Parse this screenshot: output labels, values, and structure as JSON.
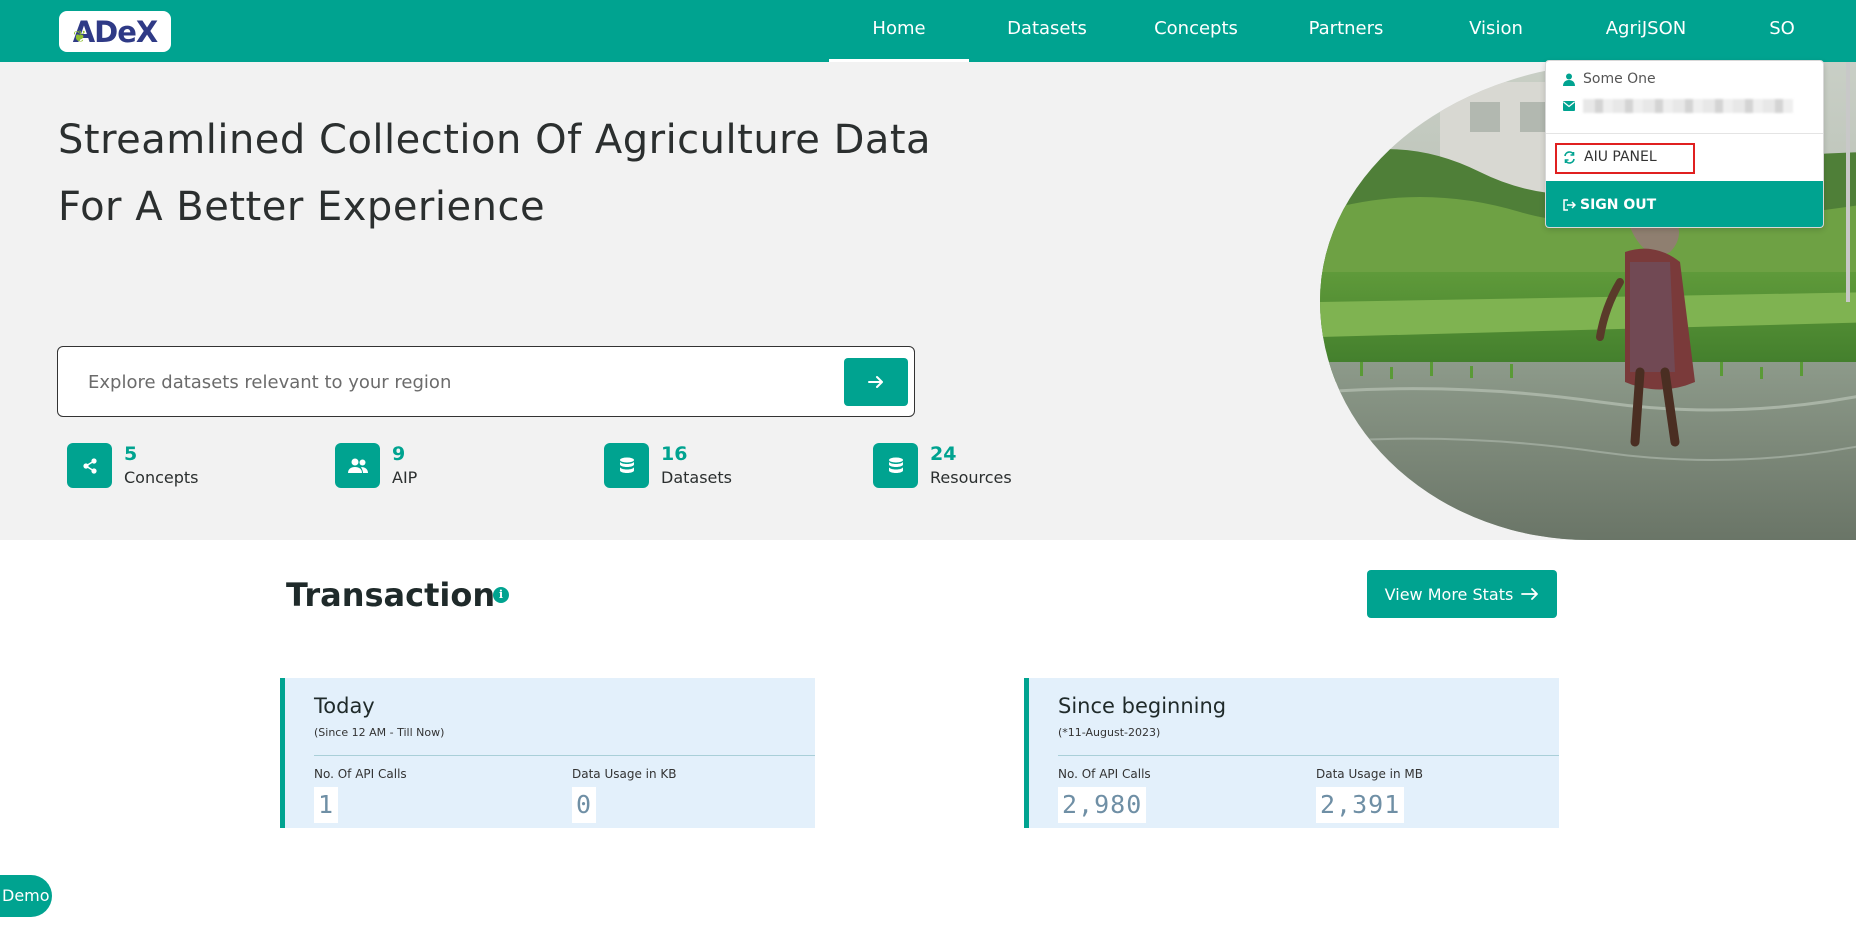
{
  "brand": {
    "logo_text": "ADeX"
  },
  "nav": {
    "items": [
      {
        "label": "Home",
        "active": true
      },
      {
        "label": "Datasets"
      },
      {
        "label": "Concepts"
      },
      {
        "label": "Partners"
      },
      {
        "label": "Vision"
      },
      {
        "label": "AgriJSON"
      },
      {
        "label": "SO"
      }
    ]
  },
  "hero": {
    "title_line1": "Streamlined Collection Of Agriculture Data",
    "title_line2": "For A Better Experience",
    "search_placeholder": "Explore datasets relevant to your region"
  },
  "stats": [
    {
      "value": "5",
      "label": "Concepts",
      "icon": "share-icon"
    },
    {
      "value": "9",
      "label": "AIP",
      "icon": "users-icon"
    },
    {
      "value": "16",
      "label": "Datasets",
      "icon": "database-icon"
    },
    {
      "value": "24",
      "label": "Resources",
      "icon": "database-icon"
    }
  ],
  "user_menu": {
    "name": "Some One",
    "panel_label": "AIU PANEL",
    "signout_label": "SIGN OUT"
  },
  "transaction": {
    "title": "Transaction",
    "more_label": "View More Stats",
    "cards": [
      {
        "title": "Today",
        "subtitle": "(Since 12 AM - Till Now)",
        "col1_label": "No. Of API Calls",
        "col1_value": "1",
        "col2_label": "Data Usage in KB",
        "col2_value": "0"
      },
      {
        "title": "Since beginning",
        "subtitle": "(*11-August-2023)",
        "col1_label": "No. Of API Calls",
        "col1_value": "2,980",
        "col2_label": "Data Usage in MB",
        "col2_value": "2,391"
      }
    ]
  },
  "demo_label": "Demo",
  "colors": {
    "accent": "#00a390",
    "card_bg": "#e3f0fb",
    "highlight": "#e02020"
  }
}
